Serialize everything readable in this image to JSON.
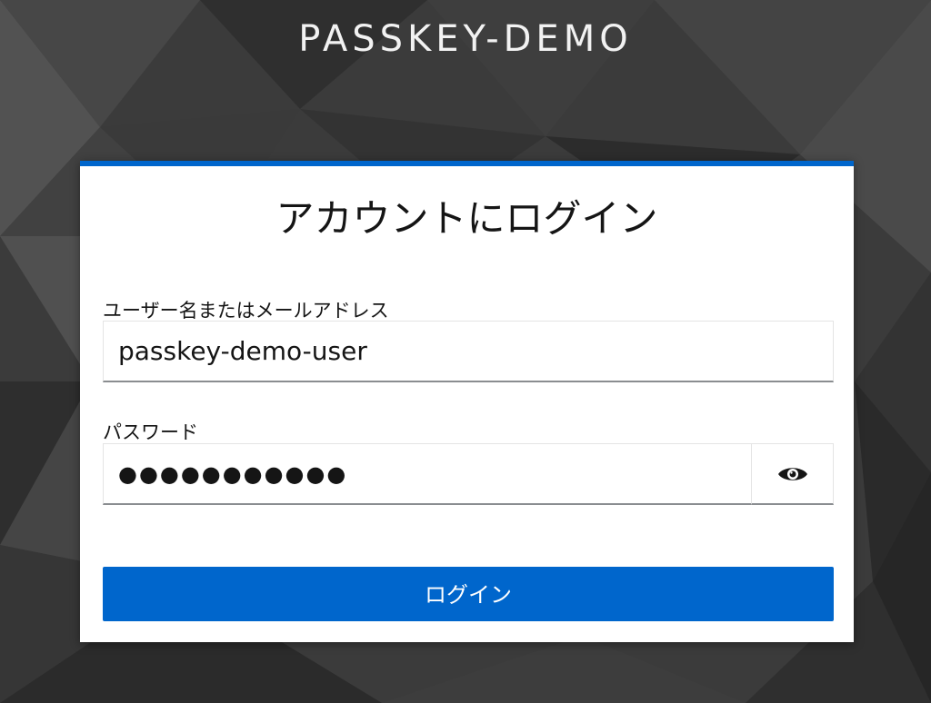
{
  "realm": {
    "title": "PASSKEY-DEMO"
  },
  "login_card": {
    "title": "アカウントにログイン",
    "accent_color": "#0066cc",
    "username": {
      "label": "ユーザー名またはメールアドレス",
      "value": "passkey-demo-user"
    },
    "password": {
      "label": "パスワード",
      "masked_value": "●●●●●●●●●●●",
      "toggle_icon": "eye-icon"
    },
    "submit_label": "ログイン"
  }
}
